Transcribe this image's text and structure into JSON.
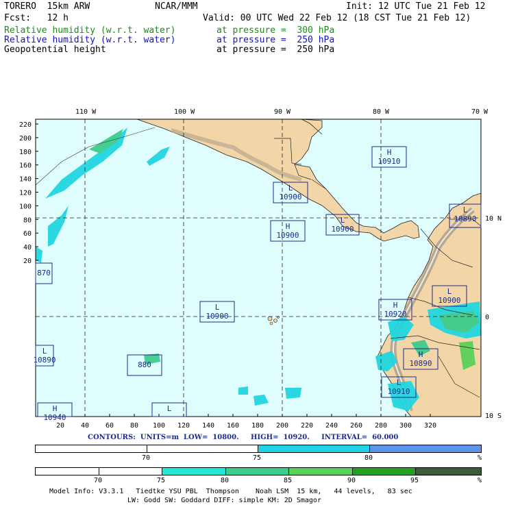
{
  "header": {
    "model": "TORERO  15km ARW",
    "org": "NCAR/MMM",
    "init": "Init: 12 UTC Tue 21 Feb 12",
    "fcst": "Fcst:   12 h",
    "valid": "Valid: 00 UTC Wed 22 Feb 12 (18 CST Tue 21 Feb 12)",
    "fields": [
      {
        "name": "Relative humidity (w.r.t. water)",
        "level": "at pressure =  300 hPa",
        "color": "#1a8c1a"
      },
      {
        "name": "Relative humidity (w.r.t. water)",
        "level": "at pressure =  250 hPa",
        "color": "#1010c8"
      },
      {
        "name": "Geopotential height",
        "level": "at pressure =  250 hPa",
        "color": "#000000"
      }
    ]
  },
  "map": {
    "ocean_color": "#e0fdfd",
    "land_color": "#f2d6a8",
    "top_lon_labels": [
      "110 W",
      "100 W",
      "90 W",
      "80 W",
      "70 W"
    ],
    "right_lat_labels": [
      "10 N",
      "0",
      "10 S"
    ],
    "left_y_labels": [
      "220",
      "200",
      "180",
      "160",
      "140",
      "120",
      "100",
      "80",
      "60",
      "40",
      "20"
    ],
    "bottom_x_labels": [
      "20",
      "40",
      "60",
      "80",
      "100",
      "120",
      "140",
      "160",
      "180",
      "200",
      "220",
      "240",
      "260",
      "280",
      "300",
      "320"
    ],
    "pressure_centers": [
      {
        "type": "H",
        "value": "10910"
      },
      {
        "type": "L",
        "value": "10900"
      },
      {
        "type": "L",
        "value": "10900"
      },
      {
        "type": "H",
        "value": "10900"
      },
      {
        "type": "L",
        "value": "10890"
      },
      {
        "type": "",
        "value": "870"
      },
      {
        "type": "L",
        "value": "10900"
      },
      {
        "type": "H",
        "value": "10920"
      },
      {
        "type": "L",
        "value": "10890"
      },
      {
        "type": "",
        "value": "880"
      },
      {
        "type": "H",
        "value": "10890"
      },
      {
        "type": "L",
        "value": "10910"
      },
      {
        "type": "H",
        "value": "10940"
      },
      {
        "type": "L",
        "value": ""
      },
      {
        "type": "L",
        "value": "10900"
      }
    ]
  },
  "contours": {
    "text": "CONTOURS:  UNITS=m  LOW=  10800.     HIGH=  10920.     INTERVAL=  60.000"
  },
  "colorbar_250": {
    "segments": [
      {
        "label": "70",
        "color": "#ffffff"
      },
      {
        "label": "75",
        "color": "#ffffff"
      },
      {
        "label": "80",
        "color": "#22d2e6"
      },
      {
        "label": "",
        "color": "#5b94e8"
      }
    ],
    "unit": "%"
  },
  "colorbar_300": {
    "segments": [
      {
        "label": "70",
        "color": "#ffffff"
      },
      {
        "label": "75",
        "color": "#ffffff"
      },
      {
        "label": "80",
        "color": "#22e6d6"
      },
      {
        "label": "85",
        "color": "#3ccc8c"
      },
      {
        "label": "90",
        "color": "#5ad05a"
      },
      {
        "label": "95",
        "color": "#22a022"
      },
      {
        "label": "",
        "color": "#3c5c3c"
      }
    ],
    "unit": "%"
  },
  "footer": {
    "line1": "Model Info: V3.3.1   Tiedtke YSU PBL  Thompson    Noah LSM  15 km,   44 levels,   83 sec",
    "line2": "LW: Godd SW: Goddard DIFF: simple KM: 2D Smagor"
  }
}
